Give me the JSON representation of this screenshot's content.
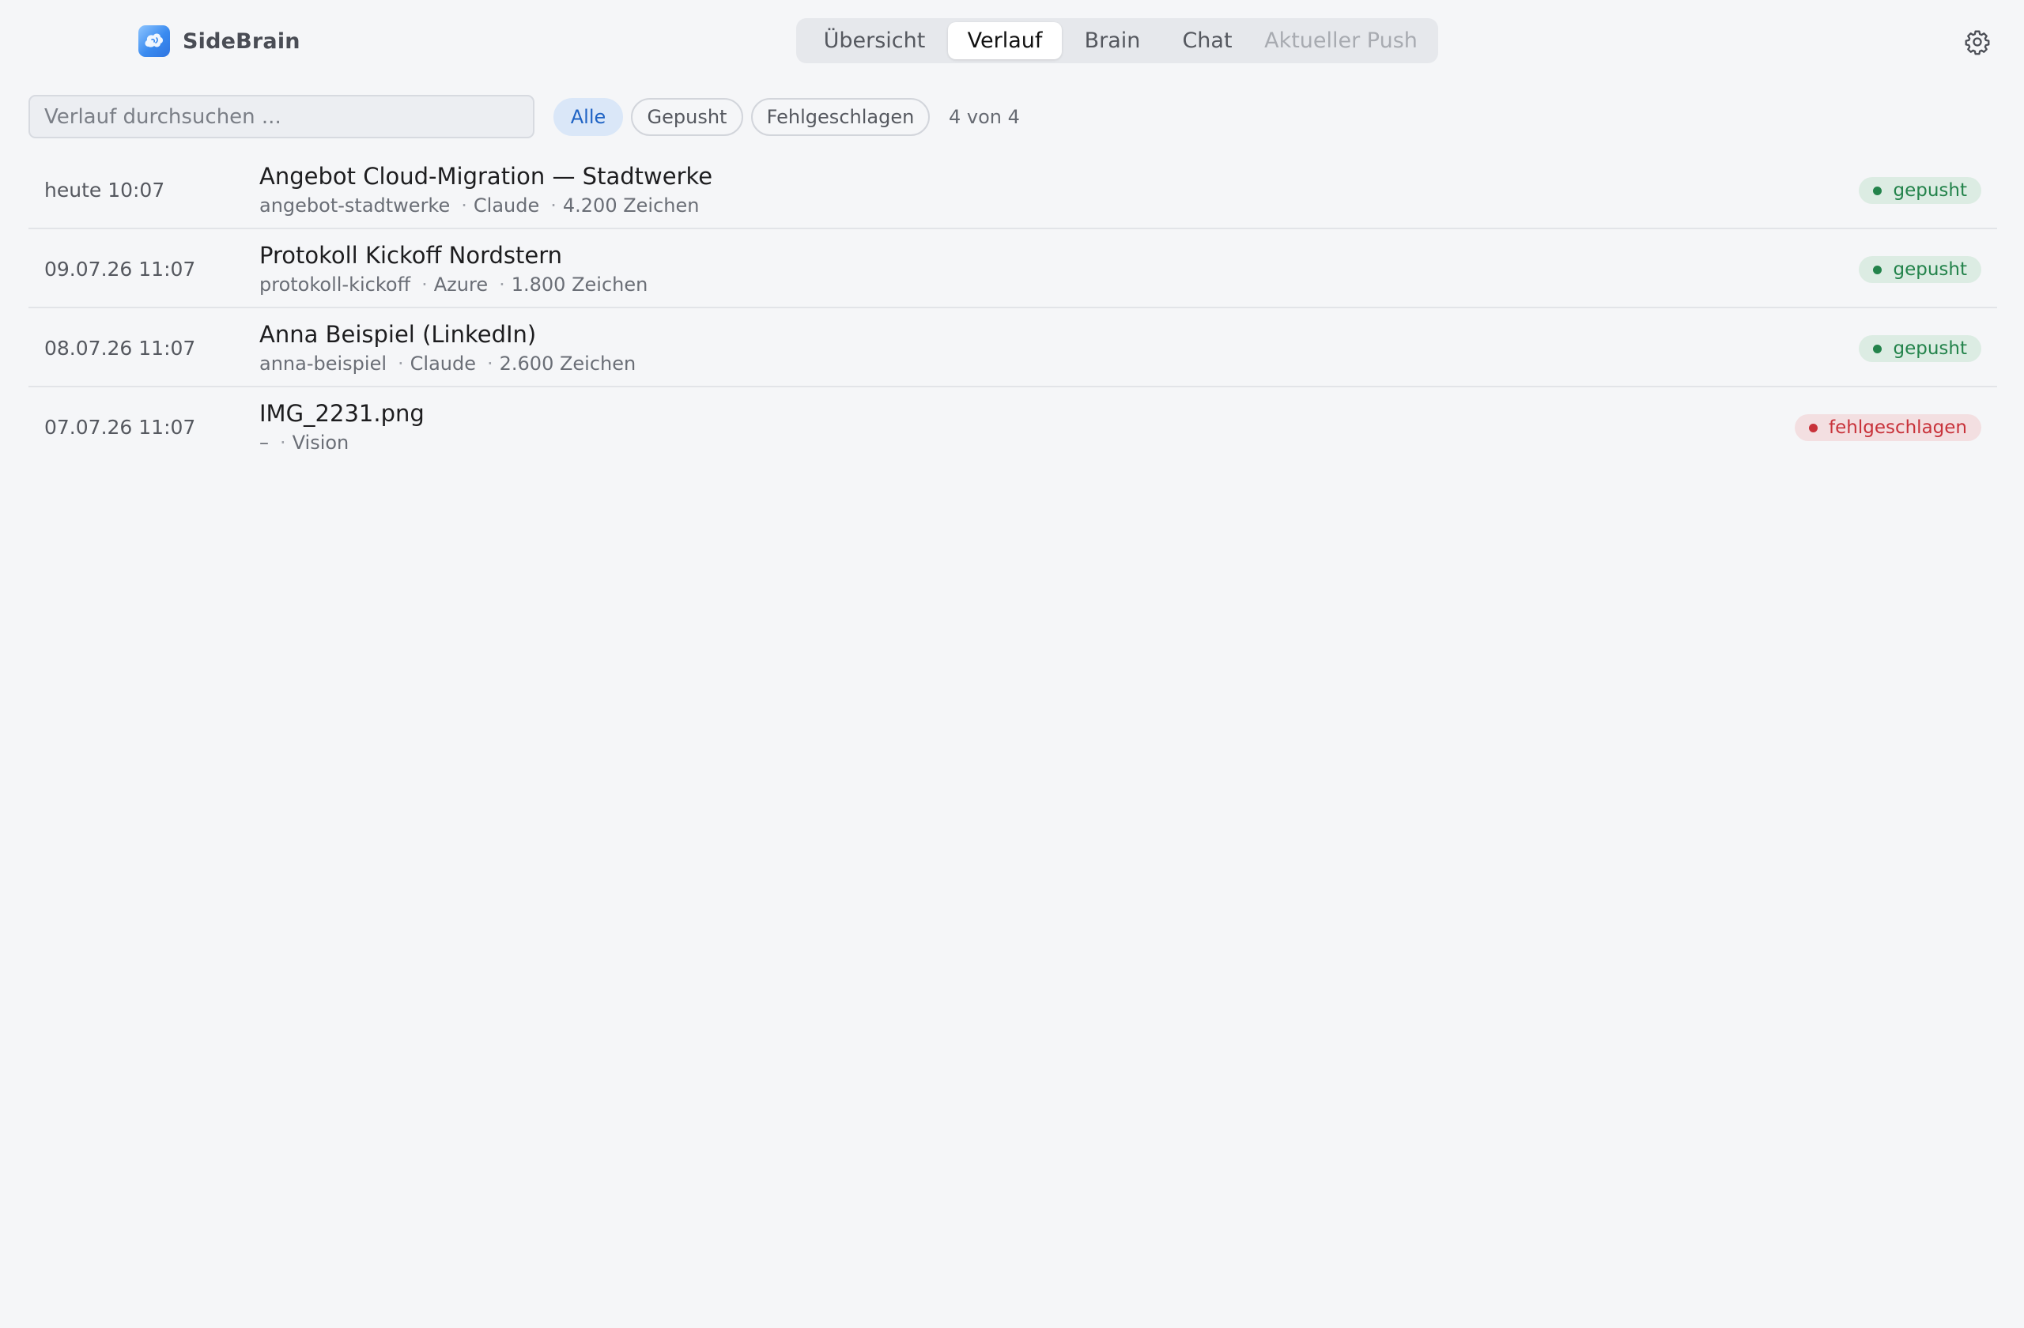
{
  "app": {
    "name": "SideBrain"
  },
  "tabs": [
    {
      "label": "Übersicht",
      "state": "normal"
    },
    {
      "label": "Verlauf",
      "state": "active"
    },
    {
      "label": "Brain",
      "state": "normal"
    },
    {
      "label": "Chat",
      "state": "normal"
    },
    {
      "label": "Aktueller Push",
      "state": "disabled"
    }
  ],
  "header": {
    "settings_icon": "gear-icon"
  },
  "toolbar": {
    "search_placeholder": "Verlauf durchsuchen ...",
    "search_value": "",
    "filters": [
      {
        "label": "Alle",
        "active": true
      },
      {
        "label": "Gepusht",
        "active": false
      },
      {
        "label": "Fehlgeschlagen",
        "active": false
      }
    ],
    "count": "4 von 4"
  },
  "history": [
    {
      "time": "heute 10:07",
      "title": "Angebot Cloud-Migration — Stadtwerke",
      "slug": "angebot-stadtwerke",
      "engine": "Claude",
      "chars": "4.200 Zeichen",
      "status": "gepusht",
      "status_type": "ok"
    },
    {
      "time": "09.07.26 11:07",
      "title": "Protokoll Kickoff Nordstern",
      "slug": "protokoll-kickoff",
      "engine": "Azure",
      "chars": "1.800 Zeichen",
      "status": "gepusht",
      "status_type": "ok"
    },
    {
      "time": "08.07.26 11:07",
      "title": "Anna Beispiel (LinkedIn)",
      "slug": "anna-beispiel",
      "engine": "Claude",
      "chars": "2.600 Zeichen",
      "status": "gepusht",
      "status_type": "ok"
    },
    {
      "time": "07.07.26 11:07",
      "title": "IMG_2231.png",
      "slug": "–",
      "engine": "Vision",
      "chars": "",
      "status": "fehlgeschlagen",
      "status_type": "fail"
    }
  ],
  "meta_separator": "·"
}
